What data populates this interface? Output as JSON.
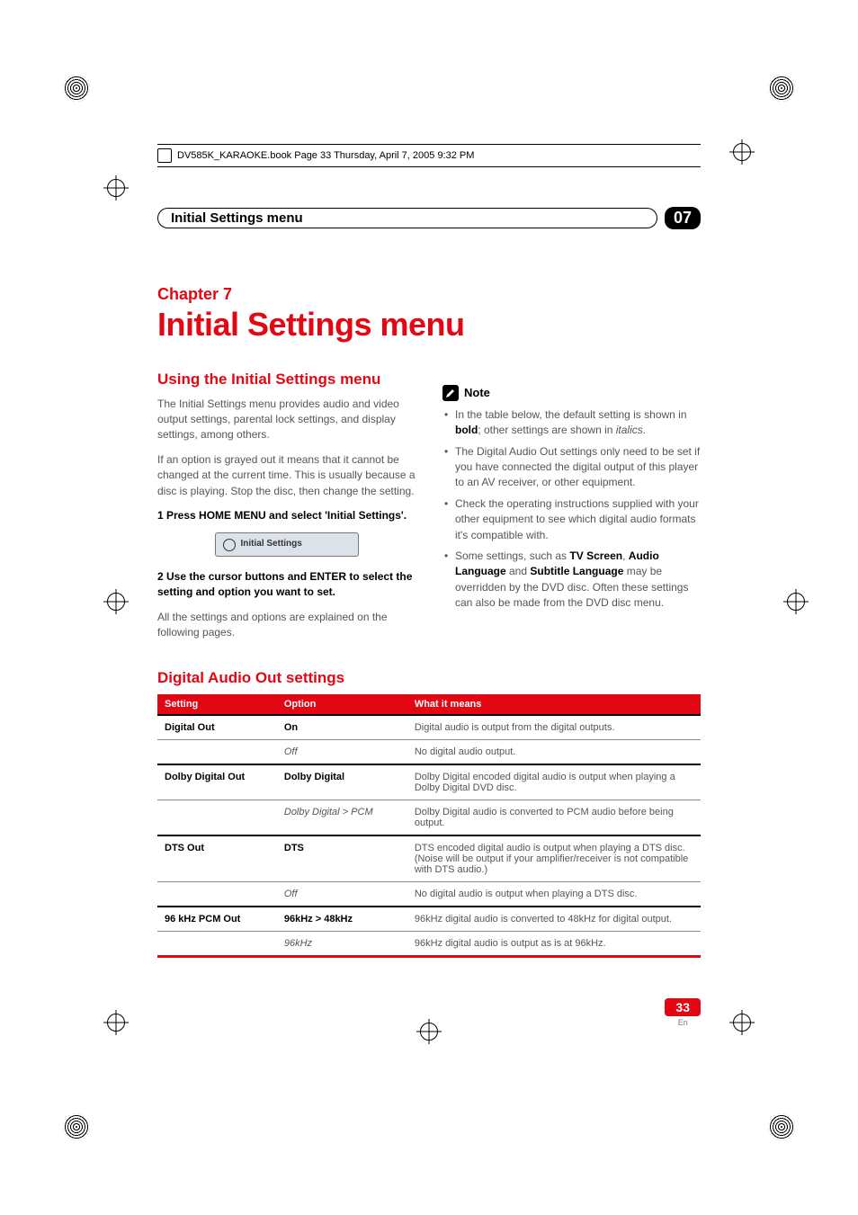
{
  "book_header": "DV585K_KARAOKE.book  Page 33  Thursday, April 7, 2005  9:32 PM",
  "section_header": {
    "title": "Initial Settings menu",
    "badge": "07"
  },
  "chapter": {
    "label": "Chapter 7",
    "title": "Initial Settings menu"
  },
  "left": {
    "h2": "Using the Initial Settings menu",
    "p1": "The Initial Settings menu provides audio and video output settings, parental lock settings, and display settings, among others.",
    "p2": "If an option is grayed out it means that it cannot be changed at the current time. This is usually because a disc is playing. Stop the disc, then change the setting.",
    "step1": "1    Press HOME MENU and select 'Initial Settings'.",
    "box": "Initial Settings",
    "step2": "2    Use the cursor buttons and ENTER to select the setting and option you want to set.",
    "p3": "All the settings and options are explained on the following pages."
  },
  "right": {
    "note_label": "Note",
    "b1a": "In the table below, the default setting is shown in ",
    "b1_bold": "bold",
    "b1b": "; other settings are shown in ",
    "b1_italic": "italics",
    "b1c": ".",
    "b2": "The Digital Audio Out settings only need to be set if you have connected the digital output of this player to an AV receiver, or other equipment.",
    "b3": "Check the operating instructions supplied with your other equipment to see which digital audio formats it's compatible with.",
    "b4a": "Some settings, such as ",
    "b4_bold1": "TV Screen",
    "b4b": ", ",
    "b4_bold2": "Audio Language",
    "b4c": " and ",
    "b4_bold3": "Subtitle Language",
    "b4d": " may be overridden by the DVD disc. Often these settings can also be made from the DVD disc menu."
  },
  "digital_h2": "Digital Audio Out settings",
  "chart_data": {
    "type": "table",
    "columns": [
      "Setting",
      "Option",
      "What it means"
    ],
    "rows": [
      {
        "setting": "Digital Out",
        "option": "On",
        "option_style": "bold",
        "desc": "Digital audio is output from the digital outputs.",
        "thick": true
      },
      {
        "setting": "",
        "option": "Off",
        "option_style": "italic",
        "desc": "No digital audio output.",
        "tline": true
      },
      {
        "setting": "Dolby Digital Out",
        "option": "Dolby Digital",
        "option_style": "bold",
        "desc": "Dolby Digital encoded digital audio is output when playing a Dolby Digital DVD disc.",
        "thick": true
      },
      {
        "setting": "",
        "option": "Dolby Digital > PCM",
        "option_style": "italic",
        "desc": "Dolby Digital audio is converted to PCM audio before being output.",
        "tline": true
      },
      {
        "setting": "DTS Out",
        "option": "DTS",
        "option_style": "bold",
        "desc": "DTS encoded digital audio is output when playing a DTS disc. (Noise will be output if your amplifier/receiver is not compatible with DTS audio.)",
        "thick": true
      },
      {
        "setting": "",
        "option": "Off",
        "option_style": "italic",
        "desc": "No digital audio is output when playing a DTS disc.",
        "tline": true
      },
      {
        "setting": "96 kHz PCM Out",
        "option": "96kHz > 48kHz",
        "option_style": "bold",
        "desc": "96kHz digital audio is converted to 48kHz for digital output.",
        "thick": true
      },
      {
        "setting": "",
        "option": "96kHz",
        "option_style": "italic",
        "desc": "96kHz digital audio is output as is at 96kHz.",
        "tline": true
      }
    ]
  },
  "page_number": "33",
  "page_lang": "En"
}
